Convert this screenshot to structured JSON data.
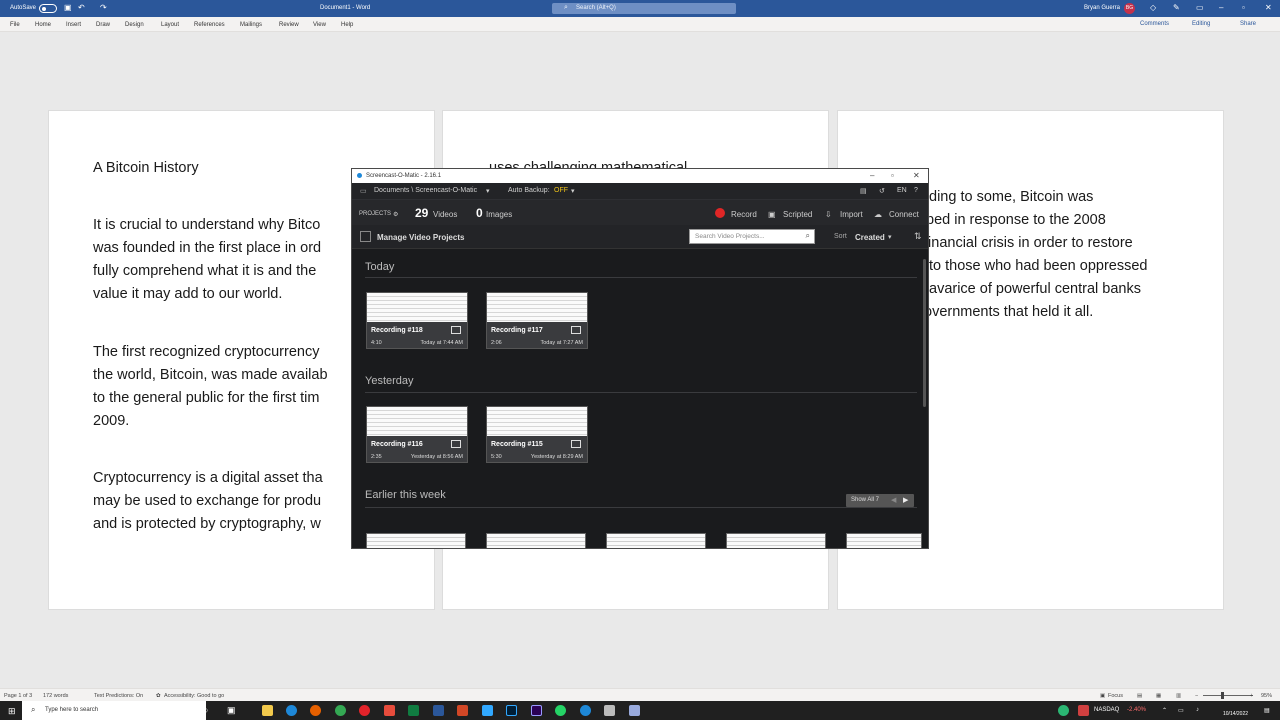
{
  "titlebar": {
    "autosave": "AutoSave",
    "autosave_state": "Off",
    "doc_title": "Document1 - Word",
    "search_placeholder": "Search (Alt+Q)",
    "user": "Bryan Guerra",
    "avatar": "BG"
  },
  "ribbon": {
    "tabs": [
      "File",
      "Home",
      "Insert",
      "Draw",
      "Design",
      "Layout",
      "References",
      "Mailings",
      "Review",
      "View",
      "Help"
    ],
    "comments": "Comments",
    "editing": "Editing",
    "share": "Share"
  },
  "doc": {
    "page1": [
      "A Bitcoin History",
      "It is crucial to understand why Bitco",
      "was founded in the first place in ord",
      "fully comprehend what it is and the",
      "value it may add to our world.",
      "The first recognized cryptocurrency",
      "the world, Bitcoin, was made availab",
      "to the general public for the first tim",
      "2009.",
      "Cryptocurrency is a digital asset tha",
      "may be used to exchange for produ",
      "and is protected by cryptography, w"
    ],
    "page2": [
      "uses challenging mathematical"
    ],
    "page3": [
      "ding to some, Bitcoin was",
      "ped in response to the 2008",
      "financial crisis in order to restore",
      "to those who had been oppressed",
      "avarice of powerful central banks",
      "overnments that held it all."
    ]
  },
  "som": {
    "title": "Screencast-O-Matic - 2.16.1",
    "path": "Documents \\ Screencast-O-Matic",
    "backup_label": "Auto Backup:",
    "backup_value": "OFF",
    "lang": "EN",
    "projects": "PROJECTS",
    "videos_count": "29",
    "videos_label": "Videos",
    "images_count": "0",
    "images_label": "Images",
    "record": "Record",
    "scripted": "Scripted",
    "import": "Import",
    "connect": "Connect",
    "manage": "Manage Video Projects",
    "search_placeholder": "Search Video Projects...",
    "sort_label": "Sort",
    "sort_value": "Created",
    "sections": {
      "today": "Today",
      "yesterday": "Yesterday",
      "earlier": "Earlier this week"
    },
    "show_all": "Show All 7",
    "recordings": [
      {
        "name": "Recording #118",
        "dur": "4:10",
        "date": "Today at 7:44 AM"
      },
      {
        "name": "Recording #117",
        "dur": "2:06",
        "date": "Today at 7:27 AM"
      },
      {
        "name": "Recording #116",
        "dur": "2:35",
        "date": "Yesterday at 8:56 AM"
      },
      {
        "name": "Recording #115",
        "dur": "5:30",
        "date": "Yesterday at 8:29 AM"
      }
    ],
    "accent": "#e02626"
  },
  "status": {
    "page": "Page 1 of 3",
    "words": "172 words",
    "predictions": "Text Predictions: On",
    "accessibility": "Accessibility: Good to go",
    "focus": "Focus",
    "zoom": "95%"
  },
  "taskbar": {
    "search": "Type here to search",
    "nasdaq": "NASDAQ",
    "nasdaq_change": "-2.40%",
    "date": "10/14/2022"
  }
}
